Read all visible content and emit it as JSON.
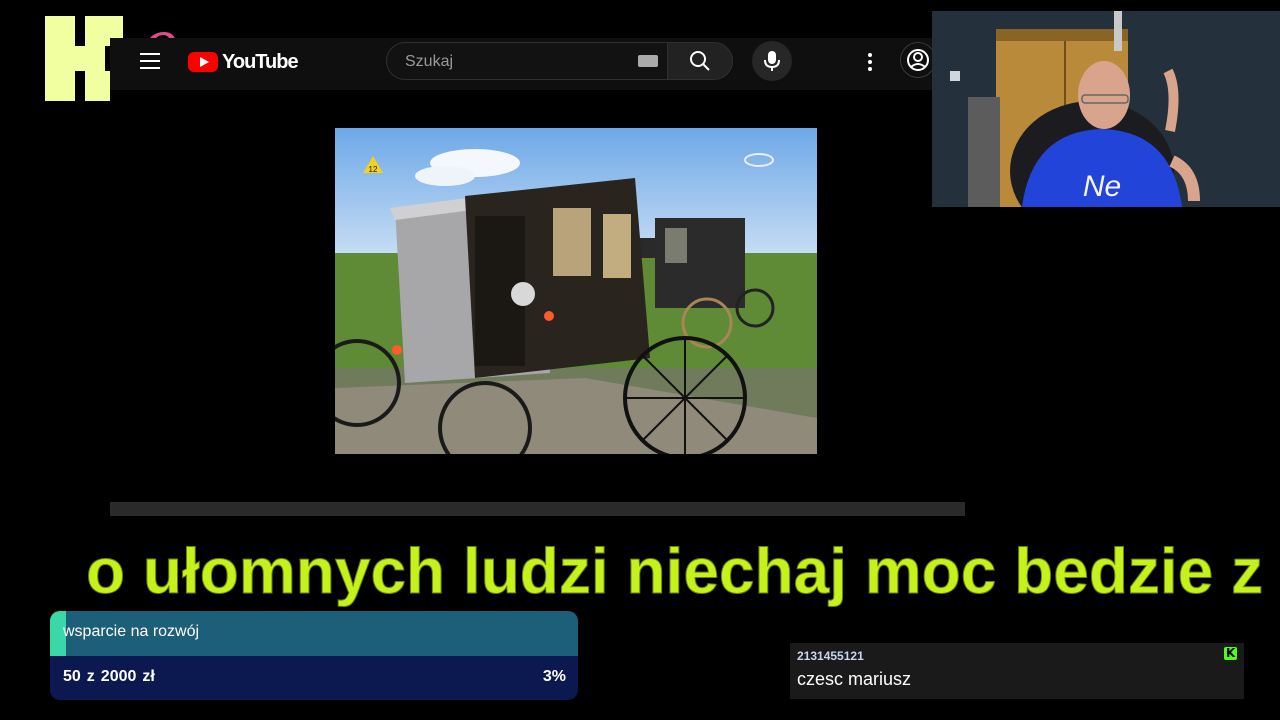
{
  "youtube": {
    "logo_text": "YouTube",
    "search_placeholder": "Szukaj",
    "icons": [
      "menu-icon",
      "search-icon",
      "keyboard-icon",
      "microphone-icon",
      "more-vertical-icon",
      "account-icon"
    ]
  },
  "video": {
    "age_rating": "12",
    "progress_fraction": 0
  },
  "ticker": {
    "text": "o ułomnych ludzi niechaj moc bedzie z n"
  },
  "donation_goal": {
    "title": "wsparcie na rozwój",
    "current": "50",
    "separator": "z",
    "target": "2000",
    "currency": "zł",
    "percent_label": "3%",
    "percent": 3
  },
  "chat": {
    "username": "2131455121",
    "message": "czesc mariusz"
  },
  "colors": {
    "ticker": "#c6f21c",
    "goal_top": "#1d5f78",
    "goal_fill": "#3ad8a8",
    "goal_bottom": "#0c1850",
    "kick": "#53fc18",
    "logo_k": "#f2ffa0",
    "logo_9": "#d94f86"
  }
}
